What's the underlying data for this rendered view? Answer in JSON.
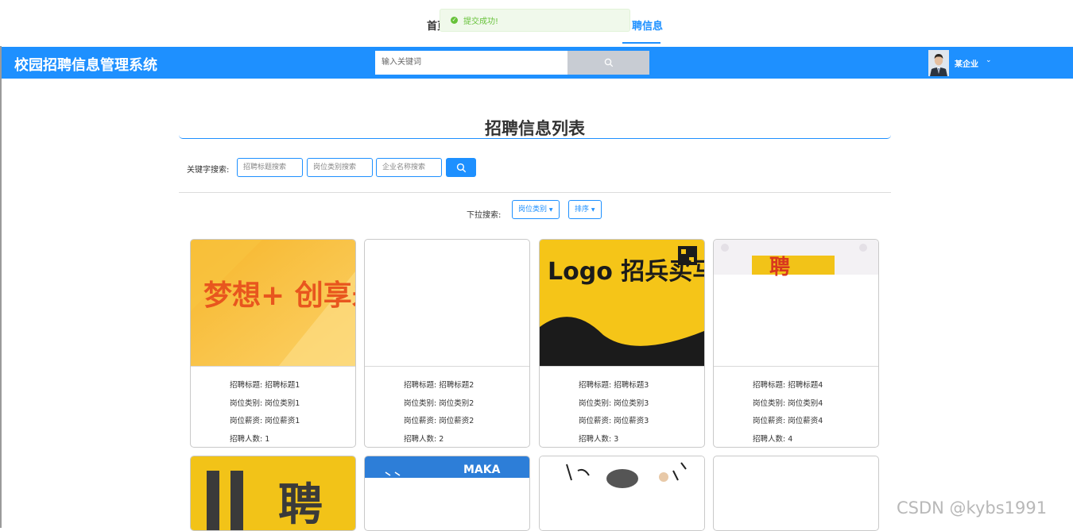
{
  "nav": {
    "items": [
      {
        "label": "首页"
      },
      {
        "label": "聘信息"
      }
    ]
  },
  "toast": {
    "message": "提交成功!"
  },
  "header": {
    "app_title": "校园招聘信息管理系统",
    "search_placeholder": "输入关键词",
    "username": "某企业",
    "accent_color": "#1e90ff"
  },
  "page": {
    "title": "招聘信息列表"
  },
  "filters": {
    "keyword_label": "关键字搜索:",
    "keyword_inputs": [
      {
        "placeholder": "招聘标题搜索"
      },
      {
        "placeholder": "岗位类别搜索"
      },
      {
        "placeholder": "企业名称搜索"
      }
    ],
    "dropdown_label": "下拉搜索:",
    "dropdowns": [
      {
        "label": "岗位类别"
      },
      {
        "label": "排序"
      }
    ]
  },
  "cards": [
    {
      "image": "梦想+ 创享未来 取胜有师",
      "title_line": "招聘标题: 招聘标题1",
      "category_line": "岗位类别: 岗位类别1",
      "salary_line": "岗位薪资: 岗位薪资1",
      "count_line": "招聘人数: 1"
    },
    {
      "image": "",
      "title_line": "招聘标题: 招聘标题2",
      "category_line": "岗位类别: 岗位类别2",
      "salary_line": "岗位薪资: 岗位薪资2",
      "count_line": "招聘人数: 2"
    },
    {
      "image": "Logo 招兵买马 招聘 JOIN US",
      "title_line": "招聘标题: 招聘标题3",
      "category_line": "岗位类别: 岗位类别3",
      "salary_line": "岗位薪资: 岗位薪资3",
      "count_line": "招聘人数: 3"
    },
    {
      "image": "聘",
      "title_line": "招聘标题: 招聘标题4",
      "category_line": "岗位类别: 岗位类别4",
      "salary_line": "岗位薪资: 岗位薪资4",
      "count_line": "招聘人数: 4"
    }
  ],
  "cards_row2": [
    {
      "image": "聘"
    },
    {
      "image": "MAKA"
    },
    {
      "image": ""
    },
    {
      "image": ""
    }
  ],
  "watermark": "CSDN @kybs1991"
}
